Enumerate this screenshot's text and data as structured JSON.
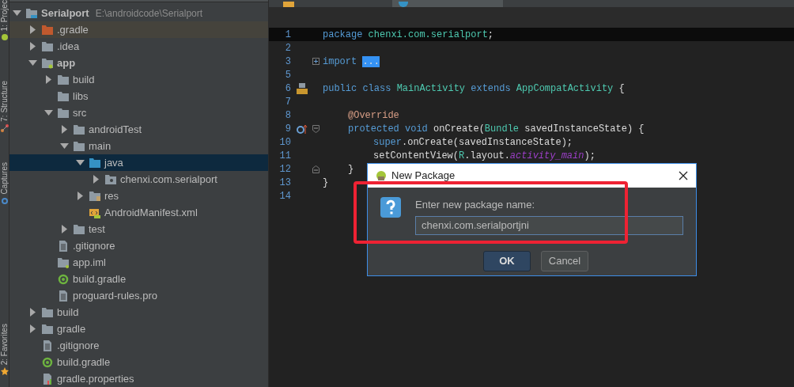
{
  "tool_strip": [
    {
      "label": "1: Projec",
      "kind": "project"
    },
    {
      "label": "7: Structure",
      "kind": "structure"
    },
    {
      "label": "Captures",
      "kind": "captures"
    },
    {
      "label": "2: Favorites",
      "kind": "favorites"
    }
  ],
  "project_tree": [
    {
      "label": "Serialport",
      "path": "E:\\androidcode\\Serialport",
      "kind": "project",
      "expanded": true,
      "selected": false,
      "children": [
        {
          "label": ".gradle",
          "kind": "excluded-folder",
          "expanded": false,
          "selected": false
        },
        {
          "label": ".idea",
          "kind": "folder",
          "expanded": false,
          "selected": false
        },
        {
          "label": "app",
          "kind": "module",
          "expanded": true,
          "selected": false,
          "children": [
            {
              "label": "build",
              "kind": "folder",
              "expanded": false,
              "selected": false
            },
            {
              "label": "libs",
              "kind": "folder",
              "selected": false
            },
            {
              "label": "src",
              "kind": "folder",
              "expanded": true,
              "selected": false,
              "children": [
                {
                  "label": "androidTest",
                  "kind": "folder",
                  "expanded": false,
                  "selected": false
                },
                {
                  "label": "main",
                  "kind": "folder",
                  "expanded": true,
                  "selected": false,
                  "children": [
                    {
                      "label": "java",
                      "kind": "source-folder",
                      "expanded": true,
                      "selected": true,
                      "children": [
                        {
                          "label": "chenxi.com.serialport",
                          "kind": "package",
                          "expanded": false,
                          "selected": false
                        }
                      ]
                    },
                    {
                      "label": "res",
                      "kind": "res-folder",
                      "expanded": false,
                      "selected": false
                    },
                    {
                      "label": "AndroidManifest.xml",
                      "kind": "manifest",
                      "selected": false
                    }
                  ]
                },
                {
                  "label": "test",
                  "kind": "folder",
                  "expanded": false,
                  "selected": false
                }
              ]
            },
            {
              "label": ".gitignore",
              "kind": "file",
              "selected": false
            },
            {
              "label": "app.iml",
              "kind": "iml",
              "selected": false
            },
            {
              "label": "build.gradle",
              "kind": "gradle",
              "selected": false
            },
            {
              "label": "proguard-rules.pro",
              "kind": "file",
              "selected": false
            }
          ]
        },
        {
          "label": "build",
          "kind": "folder",
          "expanded": false,
          "selected": false
        },
        {
          "label": "gradle",
          "kind": "folder",
          "expanded": false,
          "selected": false
        },
        {
          "label": ".gitignore",
          "kind": "file",
          "selected": false
        },
        {
          "label": "build.gradle",
          "kind": "gradle",
          "selected": false
        },
        {
          "label": "gradle.properties",
          "kind": "properties",
          "selected": false
        }
      ]
    }
  ],
  "editor_tabs": [
    {
      "kind": "xml",
      "selected": false
    },
    {
      "kind": "java",
      "selected": true
    }
  ],
  "code_lines": [
    {
      "number": "1",
      "current": true,
      "segments": [
        {
          "kind": "keyword",
          "text": "package "
        },
        {
          "kind": "type",
          "text": "chenxi.com.serialport"
        },
        {
          "kind": "plain",
          "text": ";"
        }
      ]
    },
    {
      "number": "2",
      "current": false
    },
    {
      "number": "3",
      "current": false,
      "fold": {
        "kind": "expand"
      },
      "segments": [
        {
          "kind": "keyword",
          "text": "import "
        },
        {
          "kind": "folded",
          "text": "..."
        }
      ]
    },
    {
      "number": "5",
      "current": false
    },
    {
      "number": "6",
      "current": false,
      "marker": {
        "kind": "class"
      },
      "segments": [
        {
          "kind": "keyword",
          "text": "public class "
        },
        {
          "kind": "type",
          "text": "MainActivity "
        },
        {
          "kind": "keyword",
          "text": "extends "
        },
        {
          "kind": "type",
          "text": "AppCompatActivity "
        },
        {
          "kind": "plain",
          "text": "{"
        }
      ]
    },
    {
      "number": "7",
      "current": false
    },
    {
      "number": "8",
      "current": false,
      "indent": {
        "kind": "member"
      },
      "segments": [
        {
          "kind": "annotation",
          "text": "@Override"
        }
      ]
    },
    {
      "number": "9",
      "current": false,
      "indent": {
        "kind": "member"
      },
      "marker": {
        "kind": "override"
      },
      "fold": {
        "kind": "start"
      },
      "segments": [
        {
          "kind": "keyword",
          "text": "protected void "
        },
        {
          "kind": "plain",
          "text": "onCreate("
        },
        {
          "kind": "type",
          "text": "Bundle "
        },
        {
          "kind": "plain",
          "text": "savedInstanceState) {"
        }
      ]
    },
    {
      "number": "10",
      "current": false,
      "indent": {
        "kind": "body"
      },
      "segments": [
        {
          "kind": "keyword",
          "text": "super"
        },
        {
          "kind": "plain",
          "text": ".onCreate(savedInstanceState);"
        }
      ]
    },
    {
      "number": "11",
      "current": false,
      "indent": {
        "kind": "body"
      },
      "segments": [
        {
          "kind": "plain",
          "text": "setContentView("
        },
        {
          "kind": "type",
          "text": "R"
        },
        {
          "kind": "plain",
          "text": ".layout."
        },
        {
          "kind": "field",
          "text": "activity_main"
        },
        {
          "kind": "plain",
          "text": ");"
        }
      ]
    },
    {
      "number": "12",
      "current": false,
      "indent": {
        "kind": "member"
      },
      "fold": {
        "kind": "end"
      },
      "segments": [
        {
          "kind": "plain",
          "text": "}"
        }
      ]
    },
    {
      "number": "13",
      "current": false,
      "segments": [
        {
          "kind": "plain",
          "text": "}"
        }
      ]
    },
    {
      "number": "14",
      "current": false
    }
  ],
  "dialog": {
    "title": "New Package",
    "prompt": "Enter new package name:",
    "value": "chenxi.com.serialportjni",
    "buttons": [
      {
        "label": "OK",
        "kind": "default"
      },
      {
        "label": "Cancel",
        "kind": "normal"
      }
    ]
  }
}
